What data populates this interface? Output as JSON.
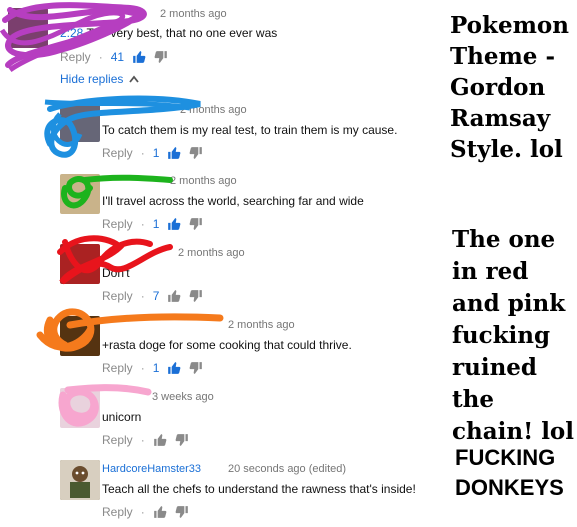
{
  "comments": [
    {
      "author": "",
      "time": "2 months ago",
      "timestamp_link": "2:28",
      "text": "The very best, that no one ever was",
      "reply_label": "Reply",
      "likes": "41",
      "scribble_color": "#b63ec0"
    },
    {
      "author": "",
      "time": "2 months ago",
      "text": "To catch them is my real test, to train them is my cause.",
      "reply_label": "Reply",
      "likes": "1",
      "scribble_color": "#1e90e0"
    },
    {
      "author": "",
      "time": "2 months ago",
      "text": "I'll travel across the world, searching far and wide",
      "reply_label": "Reply",
      "likes": "1",
      "scribble_color": "#1db31d"
    },
    {
      "author": "",
      "time": "2 months ago",
      "text": "Don't",
      "reply_label": "Reply",
      "likes": "7",
      "scribble_color": "#e8141c"
    },
    {
      "author": "",
      "time": "2 months ago",
      "text": "+rasta doge for some cooking that could thrive.",
      "reply_label": "Reply",
      "likes": "1",
      "scribble_color": "#f57a1c"
    },
    {
      "author": "",
      "time": "3 weeks ago",
      "text": "unicorn",
      "reply_label": "Reply",
      "likes": "",
      "scribble_color": "#f7a6cf"
    },
    {
      "author": "HardcoreHamster33",
      "time": "20 seconds ago (edited)",
      "text": "Teach all the chefs to understand the rawness that's inside!",
      "reply_label": "Reply",
      "likes": ""
    }
  ],
  "hide_replies_label": "Hide replies",
  "captions": {
    "top": "Pokemon Theme - Gordon Ramsay Style. lol",
    "middle": "The one in red and pink fucking ruined the chain! lol",
    "bottom": "FUCKING DONKEYS"
  },
  "colors": {
    "link": "#1a6fd6",
    "like_active": "#1a6fd6",
    "icon_gray": "#8a8a8a"
  }
}
